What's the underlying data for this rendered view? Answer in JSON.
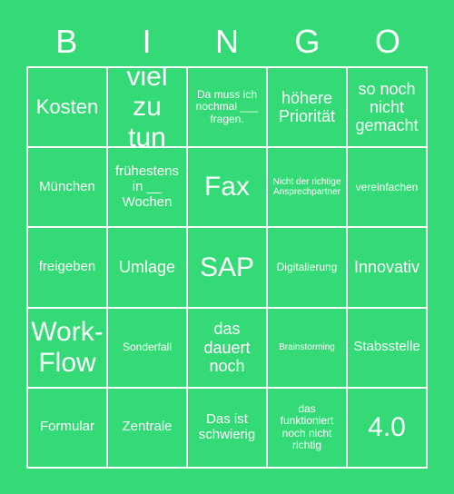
{
  "card": {
    "title_letters": [
      "B",
      "I",
      "N",
      "G",
      "O"
    ],
    "background_color": "#33da76",
    "cell_color": "#33da76",
    "grid_line_color": "#ffffff",
    "text_color": "#ffffff"
  },
  "grid": {
    "rows": 5,
    "columns": 5,
    "cells": [
      {
        "text": "Kosten",
        "size": "lg"
      },
      {
        "text": "viel zu tun",
        "size": "xl"
      },
      {
        "text": "Da muss ich nochmal ___ fragen.",
        "size": "xs"
      },
      {
        "text": "höhere Priorität",
        "size": "md"
      },
      {
        "text": "so noch nicht gemacht",
        "size": "md"
      },
      {
        "text": "München",
        "size": "sm"
      },
      {
        "text": "frühestens in __ Wochen",
        "size": "sm"
      },
      {
        "text": "Fax",
        "size": "xl"
      },
      {
        "text": "Nicht der richtige Ansprechpartner",
        "size": "xxs"
      },
      {
        "text": "vereinfachen",
        "size": "xs"
      },
      {
        "text": "freigeben",
        "size": "sm"
      },
      {
        "text": "Umlage",
        "size": "md"
      },
      {
        "text": "SAP",
        "size": "xl"
      },
      {
        "text": "Digitalierung",
        "size": "xs"
      },
      {
        "text": "Innovativ",
        "size": "md"
      },
      {
        "text": "Work-Flow",
        "size": "xl"
      },
      {
        "text": "Sonderfall",
        "size": "xs"
      },
      {
        "text": "das dauert noch",
        "size": "md"
      },
      {
        "text": "Brainstorming",
        "size": "xxs"
      },
      {
        "text": "Stabsstelle",
        "size": "sm"
      },
      {
        "text": "Formular",
        "size": "sm"
      },
      {
        "text": "Zentrale",
        "size": "sm"
      },
      {
        "text": "Das ist schwierig",
        "size": "sm"
      },
      {
        "text": "das funktioniert noch nicht richtig",
        "size": "xs"
      },
      {
        "text": "4.0",
        "size": "xl"
      }
    ]
  }
}
